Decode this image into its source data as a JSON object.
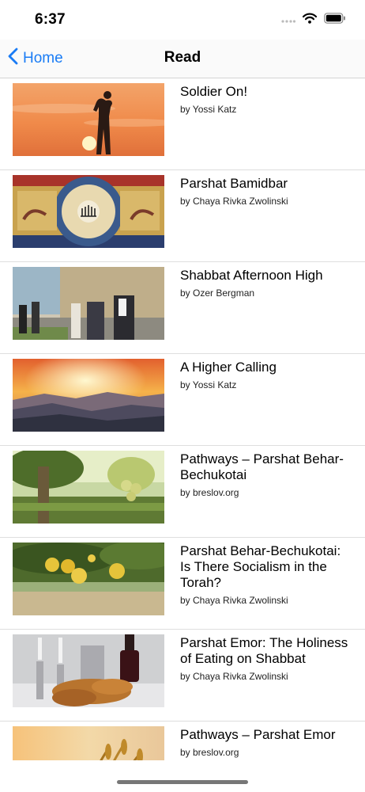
{
  "status": {
    "time": "6:37"
  },
  "nav": {
    "back_label": "Home",
    "title": "Read"
  },
  "articles": [
    {
      "title": "Soldier On!",
      "author": "by Yossi Katz"
    },
    {
      "title": "Parshat Bamidbar",
      "author": "by Chaya Rivka Zwolinski"
    },
    {
      "title": "Shabbat Afternoon High",
      "author": "by Ozer Bergman"
    },
    {
      "title": "A Higher Calling",
      "author": "by Yossi Katz"
    },
    {
      "title": "Pathways – Parshat Behar-Bechukotai",
      "author": "by breslov.org"
    },
    {
      "title": "Parshat Behar-Bechukotai: Is There Socialism in the Torah?",
      "author": "by Chaya Rivka Zwolinski"
    },
    {
      "title": "Parshat Emor: The Holiness of Eating on Shabbat",
      "author": "by Chaya Rivka Zwolinski"
    },
    {
      "title": "Pathways – Parshat Emor",
      "author": "by breslov.org"
    }
  ],
  "colors": {
    "accent": "#1a7cf5",
    "separator": "#dedede"
  },
  "icons": [
    "cellular-icon",
    "wifi-icon",
    "battery-icon",
    "chevron-left-icon"
  ]
}
